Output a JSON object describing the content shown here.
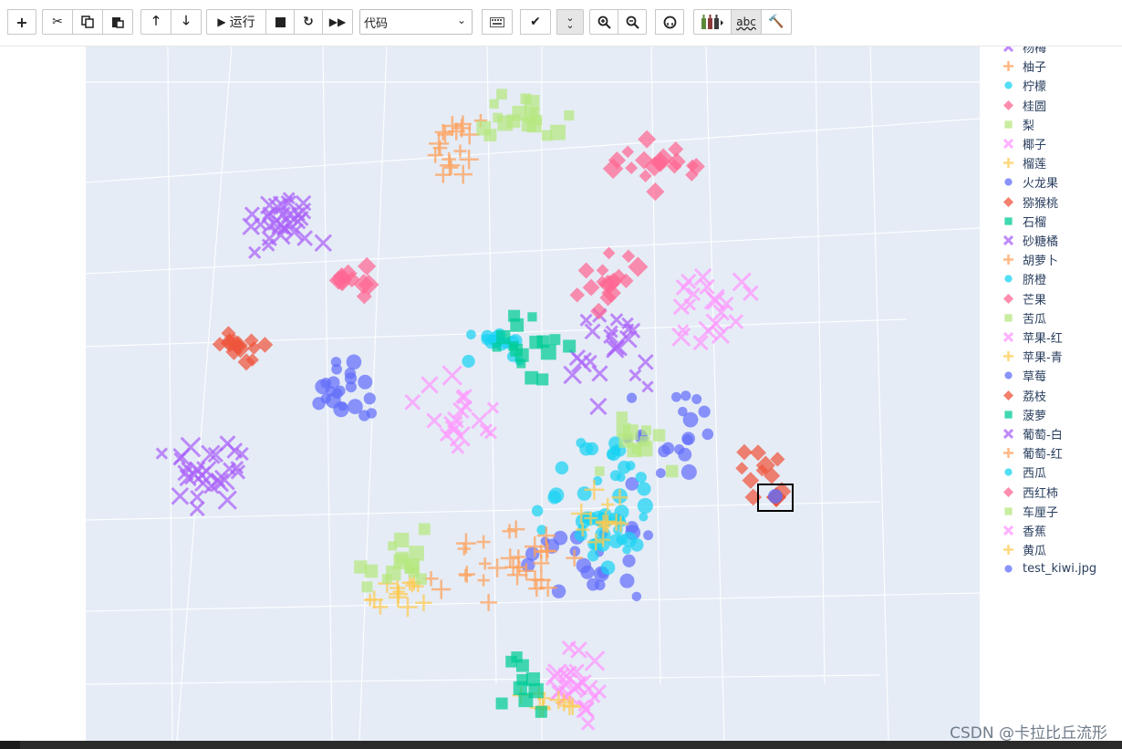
{
  "toolbar": {
    "add_icon": "plus-icon",
    "cut_icon": "scissors-icon",
    "copy_icon": "copy-icon",
    "paste_icon": "paste-icon",
    "up_icon": "arrow-up-icon",
    "down_icon": "arrow-down-icon",
    "run_label": "运行",
    "cell_type_value": "代码",
    "restart_icon": "restart-icon",
    "fast_forward_icon": "fast-forward-icon",
    "keyboard_icon": "keyboard-icon",
    "check_icon": "check-icon",
    "collapse_icon": "double-chevron-down-icon",
    "zoom_in_icon": "zoom-in-icon",
    "zoom_out_icon": "zoom-out-icon",
    "github_icon": "github-icon",
    "abc_label": "abc",
    "hammer_icon": "hammer-icon"
  },
  "legend": {
    "items": [
      {
        "label": "杨梅",
        "marker": "x",
        "color": "#ab63fa"
      },
      {
        "label": "柚子",
        "marker": "cross",
        "color": "#ffa15a"
      },
      {
        "label": "柠檬",
        "marker": "circle",
        "color": "#19d3f3"
      },
      {
        "label": "桂圆",
        "marker": "diamond",
        "color": "#ff6692"
      },
      {
        "label": "梨",
        "marker": "square",
        "color": "#b6e880"
      },
      {
        "label": "椰子",
        "marker": "x",
        "color": "#ff97ff"
      },
      {
        "label": "榴莲",
        "marker": "cross",
        "color": "#fecb52"
      },
      {
        "label": "火龙果",
        "marker": "circle",
        "color": "#636efa"
      },
      {
        "label": "猕猴桃",
        "marker": "diamond",
        "color": "#ef553b"
      },
      {
        "label": "石榴",
        "marker": "square",
        "color": "#00cc96"
      },
      {
        "label": "砂糖橘",
        "marker": "x",
        "color": "#ab63fa"
      },
      {
        "label": "胡萝卜",
        "marker": "cross",
        "color": "#ffa15a"
      },
      {
        "label": "脐橙",
        "marker": "circle",
        "color": "#19d3f3"
      },
      {
        "label": "芒果",
        "marker": "diamond",
        "color": "#ff6692"
      },
      {
        "label": "苦瓜",
        "marker": "square",
        "color": "#b6e880"
      },
      {
        "label": "苹果-红",
        "marker": "x",
        "color": "#ff97ff"
      },
      {
        "label": "苹果-青",
        "marker": "cross",
        "color": "#fecb52"
      },
      {
        "label": "草莓",
        "marker": "circle",
        "color": "#636efa"
      },
      {
        "label": "荔枝",
        "marker": "diamond",
        "color": "#ef553b"
      },
      {
        "label": "菠萝",
        "marker": "square",
        "color": "#00cc96"
      },
      {
        "label": "葡萄-白",
        "marker": "x",
        "color": "#ab63fa"
      },
      {
        "label": "葡萄-红",
        "marker": "cross",
        "color": "#ffa15a"
      },
      {
        "label": "西瓜",
        "marker": "circle",
        "color": "#19d3f3"
      },
      {
        "label": "西红柿",
        "marker": "diamond",
        "color": "#ff6692"
      },
      {
        "label": "车厘子",
        "marker": "square",
        "color": "#b6e880"
      },
      {
        "label": "香蕉",
        "marker": "x",
        "color": "#ff97ff"
      },
      {
        "label": "黄瓜",
        "marker": "cross",
        "color": "#fecb52"
      },
      {
        "label": "test_kiwi.jpg",
        "marker": "circle",
        "color": "#636efa"
      }
    ]
  },
  "plot": {
    "scene_background": "#e5ecf6",
    "grid_color": "#ffffff"
  },
  "watermark": "CSDN @卡拉比丘流形"
}
